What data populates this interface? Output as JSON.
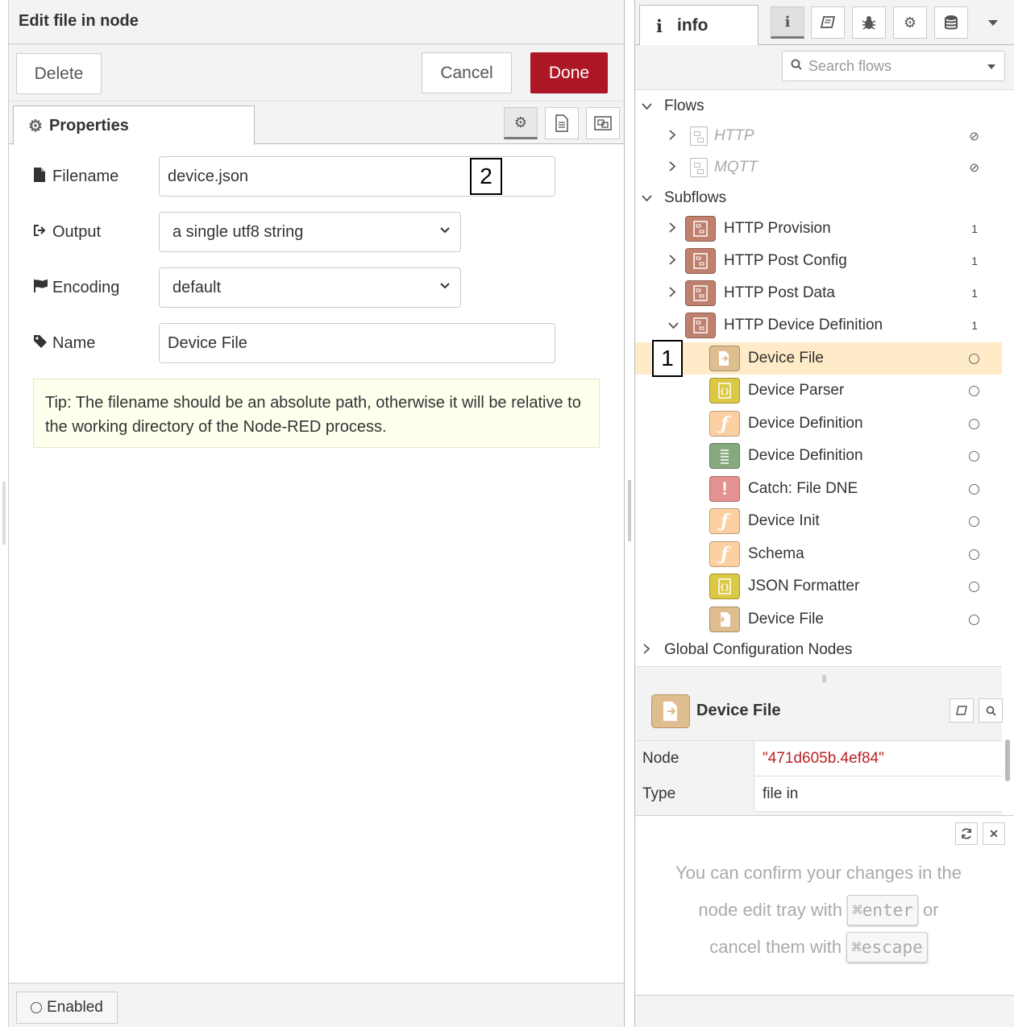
{
  "tray": {
    "title": "Edit file in node",
    "delete_label": "Delete",
    "cancel_label": "Cancel",
    "done_label": "Done",
    "tab_label": "Properties",
    "fields": {
      "filename_label": "Filename",
      "filename_value": "device.json",
      "output_label": "Output",
      "output_value": "a single utf8 string",
      "encoding_label": "Encoding",
      "encoding_value": "default",
      "name_label": "Name",
      "name_value": "Device File"
    },
    "tip": "Tip: The filename should be an absolute path, otherwise it will be relative to the working directory of the Node-RED process.",
    "enabled_label": "Enabled",
    "marker": "2",
    "colors": {
      "done": "#ad1625",
      "tip_bg": "#ffffee"
    }
  },
  "sidebar": {
    "info_tab_label": "info",
    "search_placeholder": "Search flows",
    "tree": {
      "flows_label": "Flows",
      "flows": [
        {
          "label": "HTTP"
        },
        {
          "label": "MQTT"
        }
      ],
      "subflows_label": "Subflows",
      "subflows": [
        {
          "label": "HTTP Provision",
          "count": "1"
        },
        {
          "label": "HTTP Post Config",
          "count": "1"
        },
        {
          "label": "HTTP Post Data",
          "count": "1"
        },
        {
          "label": "HTTP Device Definition",
          "count": "1"
        }
      ],
      "nodes": [
        {
          "label": "Device File",
          "icon": "file-in-icon",
          "color": "#debd8f"
        },
        {
          "label": "Device Parser",
          "icon": "json-icon",
          "color": "#dbc844"
        },
        {
          "label": "Device Definition",
          "icon": "function-icon",
          "color": "#fdd0a2"
        },
        {
          "label": "Device Definition",
          "icon": "debug-icon",
          "color": "#87a980"
        },
        {
          "label": "Catch: File DNE",
          "icon": "catch-icon",
          "color": "#e49191"
        },
        {
          "label": "Device Init",
          "icon": "function-icon",
          "color": "#fdd0a2"
        },
        {
          "label": "Schema",
          "icon": "function-icon",
          "color": "#fdd0a2"
        },
        {
          "label": "JSON Formatter",
          "icon": "json-icon",
          "color": "#dbc844"
        },
        {
          "label": "Device File",
          "icon": "file-out-icon",
          "color": "#debd8f"
        }
      ],
      "global_config_label": "Global Configuration Nodes",
      "marker": "1"
    },
    "info_panel": {
      "title": "Device File",
      "rows": [
        {
          "key": "Node",
          "value": "\"471d605b.4ef84\""
        },
        {
          "key": "Type",
          "value": "file in"
        }
      ]
    },
    "tips": {
      "line1": "You can confirm your changes in the",
      "line2_pre": "node edit tray with",
      "key_enter": "⌘enter",
      "line2_post": "or",
      "line3_pre": "cancel them with",
      "key_escape": "⌘escape"
    }
  }
}
